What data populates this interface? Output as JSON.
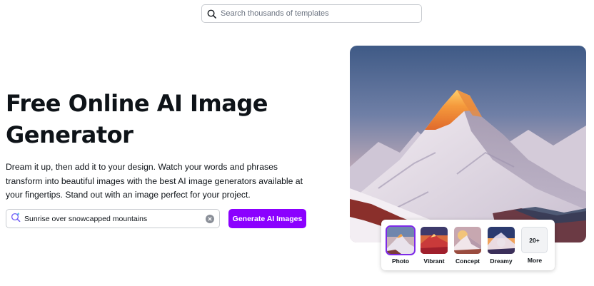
{
  "search": {
    "placeholder": "Search thousands of templates",
    "icon": "search-icon"
  },
  "hero": {
    "title": "Free Online AI Image Generator",
    "description": "Dream it up, then add it to your design. Watch your words and phrases transform into beautiful images with the best AI image generators available at your fingertips. Stand out with an image perfect for your project."
  },
  "prompt": {
    "value": "Sunrise over snowcapped mountains",
    "icon": "ai-sparkle-search-icon",
    "clear_icon": "clear-icon"
  },
  "generate_button": {
    "label": "Generate AI Images",
    "color": "#8b00ff"
  },
  "styles": {
    "selected": "Photo",
    "accent": "#7d2ae8",
    "options": [
      {
        "label": "Photo"
      },
      {
        "label": "Vibrant"
      },
      {
        "label": "Concept"
      },
      {
        "label": "Dreamy"
      },
      {
        "label": "More",
        "badge": "20+"
      }
    ]
  }
}
